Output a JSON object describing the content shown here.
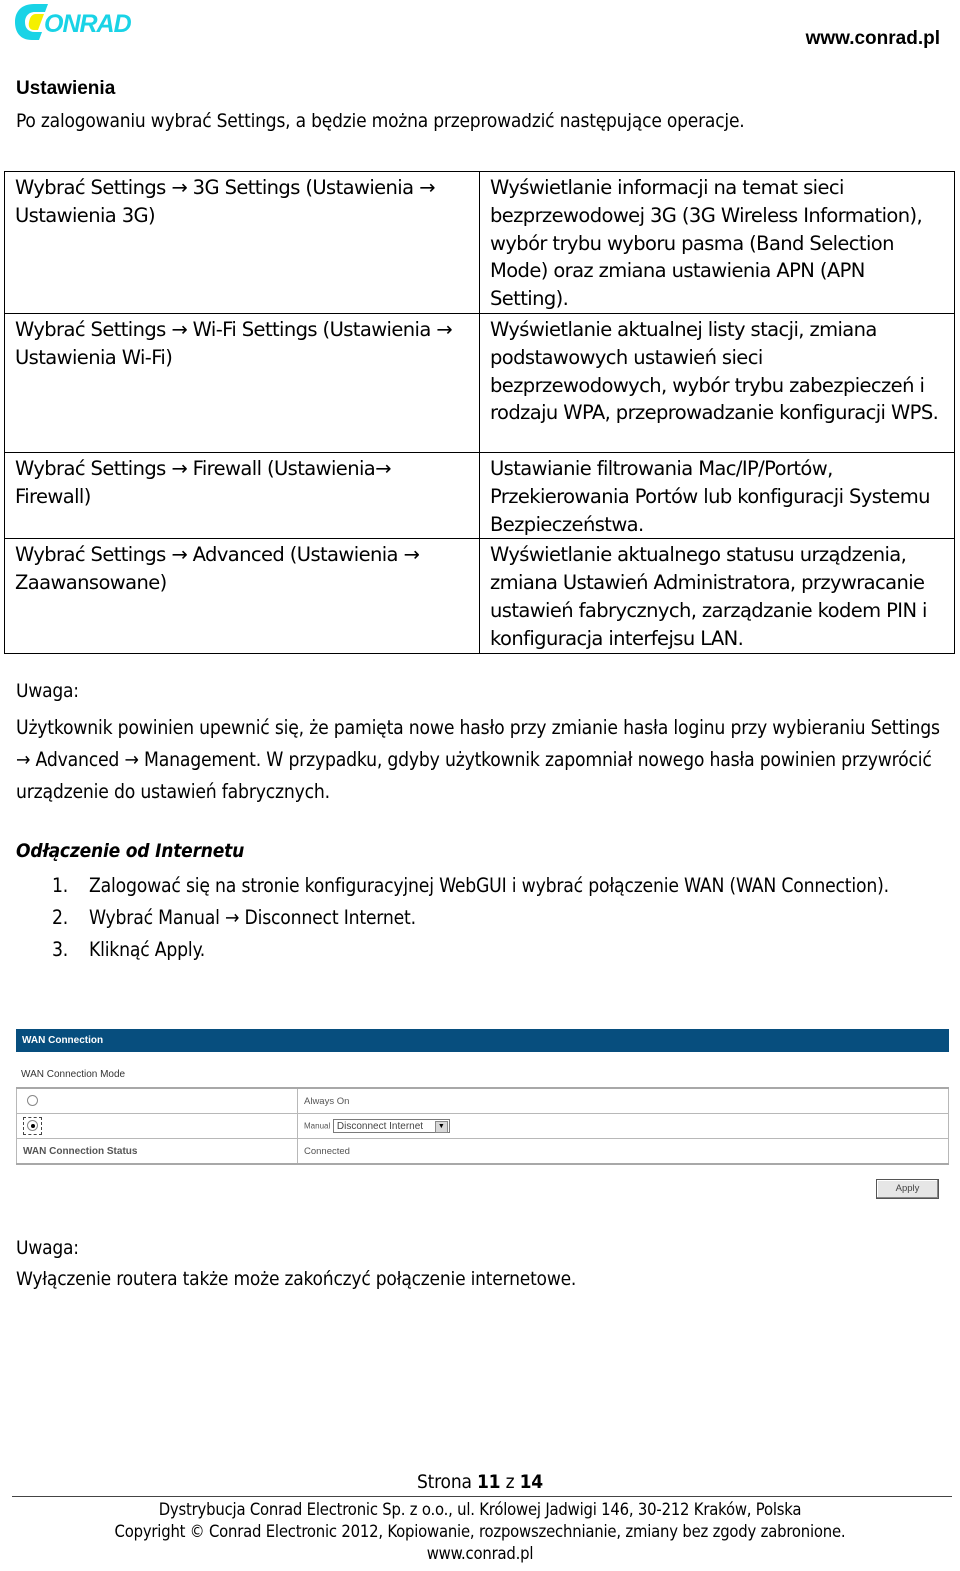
{
  "header": {
    "logo_text": "CONRAD",
    "brand_colors": {
      "primary": "#19d3e6",
      "accent": "#f5f000"
    },
    "website": "www.conrad.pl"
  },
  "settings_section": {
    "title": "Ustawienia",
    "intro": "Po zalogowaniu wybrać Settings, a będzie można przeprowadzić następujące operacje.",
    "rows": [
      {
        "path": "Wybrać Settings  → 3G Settings (Ustawienia → Ustawienia 3G)",
        "description": "Wyświetlanie informacji na temat sieci bezprzewodowej 3G (3G Wireless Information), wybór trybu wyboru pasma (Band Selection Mode) oraz zmiana ustawienia APN (APN Setting)."
      },
      {
        "path": "Wybrać Settings → Wi-Fi Settings (Ustawienia → Ustawienia Wi-Fi)",
        "description": "Wyświetlanie aktualnej listy stacji, zmiana podstawowych ustawień sieci bezprzewodowych, wybór trybu zabezpieczeń i rodzaju WPA, przeprowadzanie konfiguracji WPS."
      },
      {
        "path": "Wybrać Settings → Firewall (Ustawienia→ Firewall)",
        "description": "Ustawianie filtrowania Mac/IP/Portów, Przekierowania Portów lub konfiguracji Systemu Bezpieczeństwa."
      },
      {
        "path": "Wybrać Settings → Advanced (Ustawienia → Zaawansowane)",
        "description": "Wyświetlanie aktualnego statusu urządzenia, zmiana Ustawień Administratora, przywracanie ustawień fabrycznych, zarządzanie kodem PIN i konfiguracja interfejsu LAN."
      }
    ]
  },
  "note1": {
    "title": "Uwaga:",
    "body": "Użytkownik powinien upewnić się, że pamięta nowe hasło przy zmianie hasła loginu przy wybieraniu Settings → Advanced → Management. W przypadku, gdyby użytkownik zapomniał nowego hasła powinien przywrócić urządzenie do ustawień fabrycznych."
  },
  "disconnect_section": {
    "title": "Odłączenie od Internetu",
    "steps": [
      {
        "num": "1.",
        "text": "Zalogować się na stronie konfiguracyjnej WebGUI i wybrać połączenie WAN (WAN Connection)."
      },
      {
        "num": "2.",
        "text": "Wybrać Manual → Disconnect Internet."
      },
      {
        "num": "3.",
        "text": "Kliknąć Apply."
      }
    ]
  },
  "wan_panel": {
    "header_title": "WAN Connection",
    "header_color": "#074e7e",
    "mode_label": "WAN Connection Mode",
    "options": [
      {
        "label": "Always On",
        "selected": false
      },
      {
        "label": "Manual",
        "selected": true,
        "select_value": "Disconnect Internet"
      }
    ],
    "status_label": "WAN Connection Status",
    "status_value": "Connected",
    "apply_label": "Apply"
  },
  "note2": {
    "title": "Uwaga:",
    "body": "Wyłączenie routera także może zakończyć połączenie internetowe."
  },
  "footer": {
    "page_prefix": "Strona",
    "page_current": "11",
    "page_sep": "z",
    "page_total": "14",
    "line1": "Dystrybucja Conrad Electronic Sp. z o.o., ul. Królowej Jadwigi 146, 30-212 Kraków, Polska",
    "line2": "Copyright © Conrad Electronic 2012, Kopiowanie, rozpowszechnianie, zmiany bez zgody zabronione.",
    "line3": "www.conrad.pl"
  }
}
